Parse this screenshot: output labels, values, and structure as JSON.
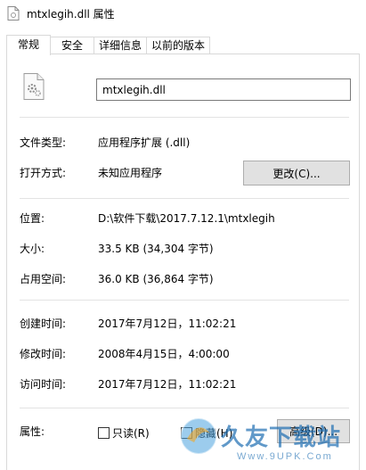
{
  "window": {
    "title": "mtxlegih.dll 属性"
  },
  "tabs": [
    {
      "label": "常规",
      "active": true
    },
    {
      "label": "安全"
    },
    {
      "label": "详细信息"
    },
    {
      "label": "以前的版本"
    }
  ],
  "general": {
    "filename": "mtxlegih.dll",
    "file_type_label": "文件类型:",
    "file_type_value": "应用程序扩展 (.dll)",
    "opens_with_label": "打开方式:",
    "opens_with_value": "未知应用程序",
    "change_button": "更改(C)...",
    "location_label": "位置:",
    "location_value": "D:\\软件下载\\2017.7.12.1\\mtxlegih",
    "size_label": "大小:",
    "size_value": "33.5 KB (34,304 字节)",
    "disk_size_label": "占用空间:",
    "disk_size_value": "36.0 KB (36,864 字节)",
    "created_label": "创建时间:",
    "created_value": "2017年7月12日，11:02:21",
    "modified_label": "修改时间:",
    "modified_value": "2008年4月15日，4:00:00",
    "accessed_label": "访问时间:",
    "accessed_value": "2017年7月12日，11:02:21",
    "attributes_label": "属性:",
    "readonly_label": "只读(R)",
    "hidden_label": "隐藏(H)",
    "advanced_button": "高级(D)..."
  },
  "watermark": {
    "main": "久友下载站",
    "sub": "Www.9UPK.Com"
  },
  "colors": {
    "border": "#d9d9d9",
    "button_bg": "#e1e1e1",
    "watermark_blue": "#1f6fb3"
  }
}
